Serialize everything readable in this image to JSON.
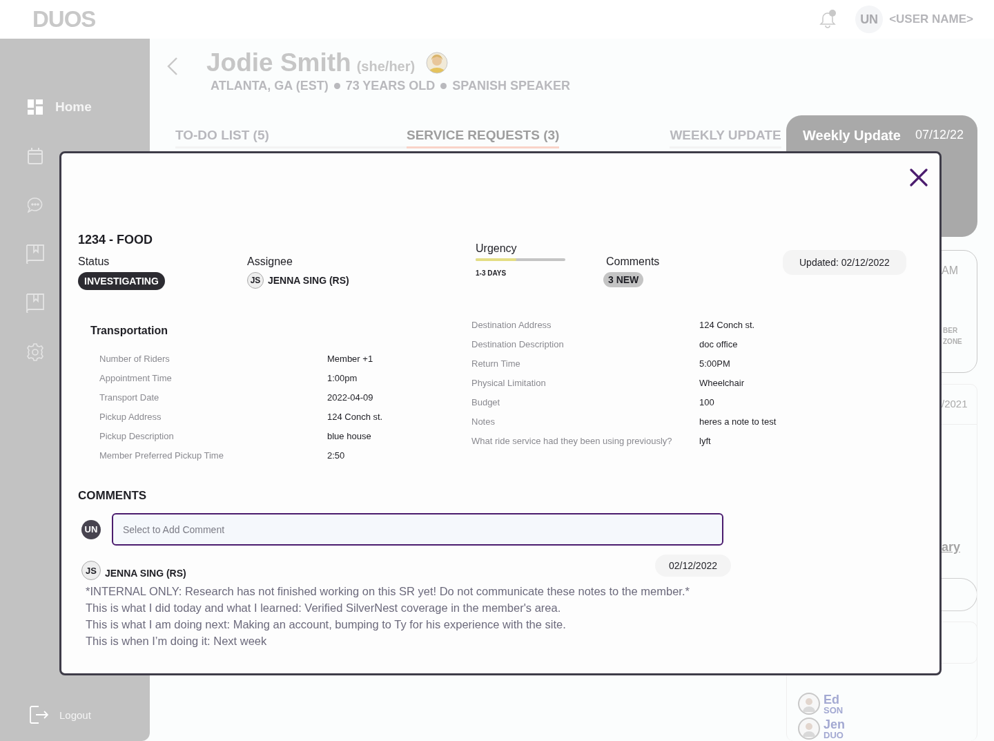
{
  "header": {
    "logo": "DUOS",
    "user_initials": "UN",
    "user_name": "<USER NAME>"
  },
  "sidebar": {
    "items": [
      {
        "kind": "dashboard",
        "label": "Home"
      },
      {
        "kind": "calendar"
      },
      {
        "kind": "chat"
      },
      {
        "kind": "book"
      },
      {
        "kind": "book"
      },
      {
        "kind": "gear"
      }
    ],
    "logout": "Logout"
  },
  "member": {
    "name": "Jodie Smith",
    "pronouns": "(she/her)",
    "location": "ATLANTA, GA (EST)",
    "age": "73 YEARS OLD",
    "language": "SPANISH SPEAKER"
  },
  "tabs": [
    {
      "label": "TO-DO LIST (5)",
      "selected": false
    },
    {
      "label": "SERVICE REQUESTS (3)",
      "selected": true
    },
    {
      "label": "WEEKLY UPDATE",
      "selected": false
    }
  ],
  "weekly_card": {
    "title": "Weekly Update",
    "date": "07/12/22"
  },
  "right_column": {
    "card_1": [
      "AM",
      "BER",
      "ZONE"
    ],
    "card_2": {
      "date": "/2021",
      "link": "ary"
    },
    "family": [
      {
        "name": "Ed",
        "relation": "SON",
        "kind": "person"
      },
      {
        "name": "Jen",
        "relation": "DUO",
        "kind": "person"
      }
    ]
  },
  "modal": {
    "title": "1234 - FOOD",
    "status": {
      "label": "Status",
      "value": "INVESTIGATING"
    },
    "assignee": {
      "label": "Assignee",
      "initials": "JS",
      "name": "JENNA SING (RS)"
    },
    "urgency": {
      "label": "Urgency",
      "level": 0.45,
      "text": "1-3 DAYS"
    },
    "comments_summary": {
      "label": "Comments",
      "badge": "3 NEW"
    },
    "updated": "Updated: 02/12/2022",
    "details": {
      "heading": "Transportation",
      "left": [
        {
          "label": "Number of Riders",
          "value": "Member +1"
        },
        {
          "label": "Appointment Time",
          "value": "1:00pm"
        },
        {
          "label": "Transport Date",
          "value": "2022-04-09"
        },
        {
          "label": "Pickup Address",
          "value": "124 Conch st."
        },
        {
          "label": "Pickup Description",
          "value": "blue house"
        },
        {
          "label": "Member Preferred Pickup Time",
          "value": "2:50"
        }
      ],
      "right": [
        {
          "label": "Destination Address",
          "value": "124 Conch st."
        },
        {
          "label": "Destination Description",
          "value": "doc office"
        },
        {
          "label": "Return Time",
          "value": "5:00PM"
        },
        {
          "label": "Physical Limitation",
          "value": "Wheelchair"
        },
        {
          "label": "Budget",
          "value": "100"
        },
        {
          "label": "Notes",
          "value": "heres a note to test"
        },
        {
          "label": "What ride service had they been using previously?",
          "value": "lyft"
        }
      ]
    },
    "comments": {
      "heading": "COMMENTS",
      "user_initials": "UN",
      "placeholder": "Select to Add Comment",
      "entries": [
        {
          "initials": "JS",
          "author": "JENNA SING (RS)",
          "date": "02/12/2022",
          "lines": [
            "*INTERNAL ONLY: Research has not finished working on this SR yet! Do not communicate these notes to the member.*",
            "This is what I did today and what I learned: Verified SilverNest coverage in the member's area.",
            "This is what I am doing next: Making an account, bumping to Ty for his experience with the site.",
            "This is when I’m doing it: Next week"
          ]
        }
      ]
    }
  }
}
